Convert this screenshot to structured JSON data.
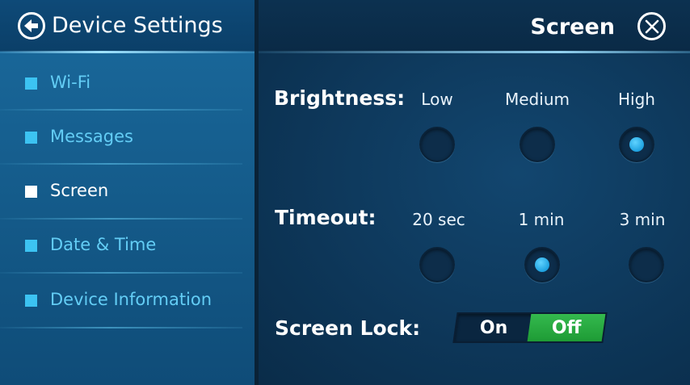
{
  "sidebar": {
    "title": "Device Settings",
    "back_icon": "back-arrow-icon",
    "items": [
      {
        "label": "Wi-Fi",
        "active": false
      },
      {
        "label": "Messages",
        "active": false
      },
      {
        "label": "Screen",
        "active": true
      },
      {
        "label": "Date & Time",
        "active": false
      },
      {
        "label": "Device Information",
        "active": false
      }
    ]
  },
  "header": {
    "title": "Screen",
    "close_icon": "close-icon"
  },
  "brightness": {
    "label": "Brightness:",
    "options": [
      "Low",
      "Medium",
      "High"
    ],
    "selected": "High"
  },
  "timeout": {
    "label": "Timeout:",
    "options": [
      "20 sec",
      "1 min",
      "3 min"
    ],
    "selected": "1 min"
  },
  "screen_lock": {
    "label": "Screen Lock:",
    "on_label": "On",
    "off_label": "Off",
    "selected": "Off"
  },
  "colors": {
    "accent": "#3cc3f2",
    "selected_toggle": "#2aab42",
    "radio_dot": "#1fa2e0"
  }
}
